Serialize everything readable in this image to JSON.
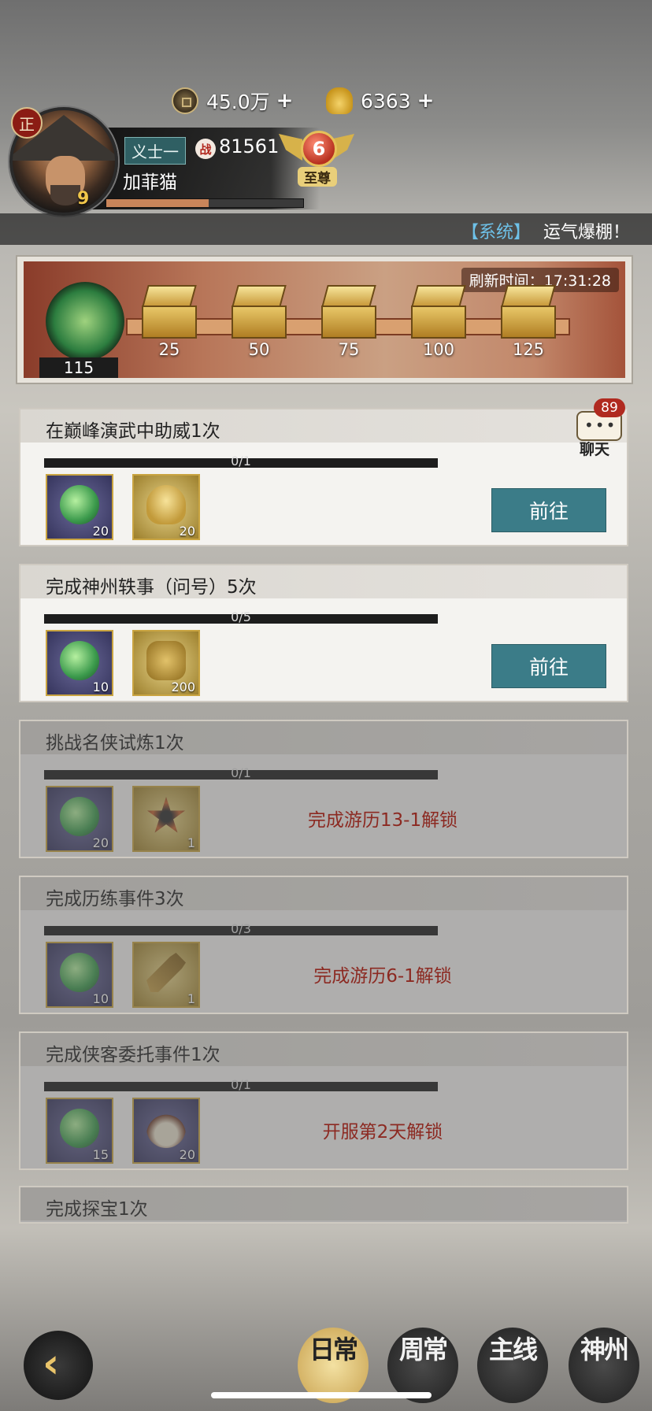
{
  "header": {
    "coins": {
      "value": "45.0万",
      "plus": "+"
    },
    "ingots": {
      "value": "6363",
      "plus": "+"
    },
    "alignment_badge": "正",
    "title_badge": "义士一",
    "power_icon": "战",
    "power": "81561",
    "player_name": "加菲猫",
    "level": "9",
    "xp_fraction": 0.52,
    "vip_level": "6",
    "vip_label": "至尊"
  },
  "ticker": {
    "tag": "【系统】",
    "message": "运气爆棚！"
  },
  "reward_track": {
    "refresh_label": "刷新时间：17:31:28",
    "token_count": "115",
    "milestones": [
      "25",
      "50",
      "75",
      "100",
      "125"
    ]
  },
  "chat": {
    "badge": "89",
    "label": "聊天",
    "dots": "•••"
  },
  "tasks": [
    {
      "title": "在巅峰演武中助威1次",
      "progress": "0/1",
      "rewards": [
        "20",
        "20"
      ],
      "action": "前往"
    },
    {
      "title": "完成神州轶事（问号）5次",
      "progress": "0/5",
      "rewards": [
        "10",
        "200"
      ],
      "action": "前往"
    },
    {
      "title": "挑战名侠试炼1次",
      "progress": "0/1",
      "rewards": [
        "20",
        "1"
      ],
      "lock": "完成游历13-1解锁"
    },
    {
      "title": "完成历练事件3次",
      "progress": "0/3",
      "rewards": [
        "10",
        "1"
      ],
      "lock": "完成游历6-1解锁"
    },
    {
      "title": "完成侠客委托事件1次",
      "progress": "0/1",
      "rewards": [
        "15",
        "20"
      ],
      "lock": "开服第2天解锁"
    },
    {
      "title": "完成探宝1次"
    }
  ],
  "nav": {
    "back": "‹",
    "tabs": [
      {
        "label": "日常",
        "active": true
      },
      {
        "label": "周常",
        "active": false
      },
      {
        "label": "主线",
        "active": false
      },
      {
        "label": "神州",
        "active": false
      }
    ]
  },
  "colors": {
    "go_button": "#3b7c88",
    "lock_text": "#8c2a22",
    "ticker_tag": "#6ec1e8"
  }
}
